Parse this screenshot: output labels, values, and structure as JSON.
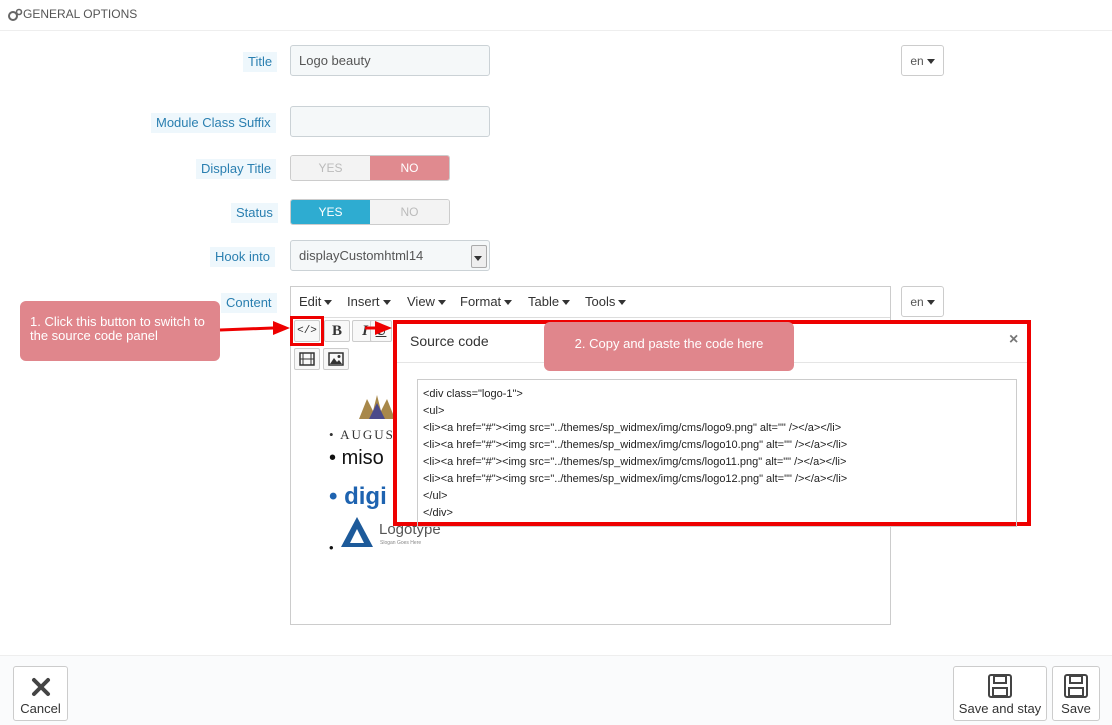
{
  "header": {
    "title": "GENERAL OPTIONS",
    "icon": "gears-icon"
  },
  "form": {
    "title_label": "Title",
    "title_value": "Logo beauty",
    "lang": "en",
    "suffix_label": "Module Class Suffix",
    "suffix_value": "",
    "display_title_label": "Display Title",
    "display_title": {
      "yes": "YES",
      "no": "NO",
      "selected": "NO"
    },
    "status_label": "Status",
    "status": {
      "yes": "YES",
      "no": "NO",
      "selected": "YES"
    },
    "hook_label": "Hook into",
    "hook_value": "displayCustomhtml14",
    "content_label": "Content",
    "content_lang": "en"
  },
  "editor": {
    "menu": [
      "Edit",
      "Insert",
      "View",
      "Format",
      "Table",
      "Tools"
    ],
    "toolbar": {
      "source": "</>",
      "bold": "B",
      "italic": "I",
      "underline": "U"
    },
    "logos": [
      "AUGUS",
      "miso",
      "digi",
      "Logotype",
      "Slogan Goes Here"
    ]
  },
  "callouts": {
    "one": "1. Click this button to switch to the source code panel",
    "two": "2. Copy and paste the code here"
  },
  "modal": {
    "title": "Source code",
    "close": "×",
    "code": "<div class=\"logo-1\">\n<ul>\n<li><a href=\"#\"><img src=\"../themes/sp_widmex/img/cms/logo9.png\" alt=\"\" /></a></li>\n<li><a href=\"#\"><img src=\"../themes/sp_widmex/img/cms/logo10.png\" alt=\"\" /></a></li>\n<li><a href=\"#\"><img src=\"../themes/sp_widmex/img/cms/logo11.png\" alt=\"\" /></a></li>\n<li><a href=\"#\"><img src=\"../themes/sp_widmex/img/cms/logo12.png\" alt=\"\" /></a></li>\n</ul>\n</div>"
  },
  "footer": {
    "cancel": "Cancel",
    "save_stay": "Save and stay",
    "save": "Save"
  },
  "colors": {
    "accent_blue": "#2eacd1",
    "toggle_no": "#e08a8f",
    "highlight_red": "#e00000",
    "callout": "#e0868c"
  }
}
